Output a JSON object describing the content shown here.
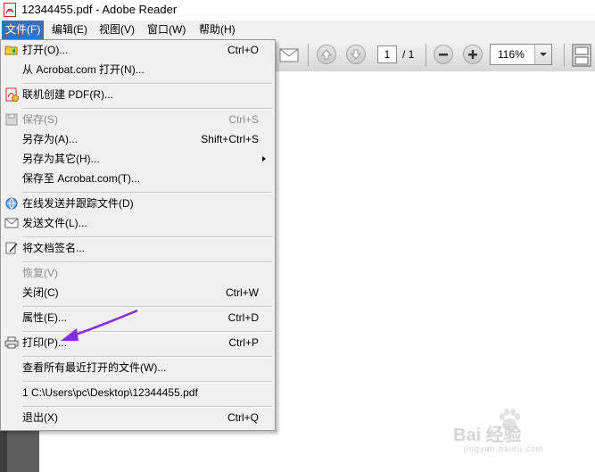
{
  "window": {
    "title": "12344455.pdf - Adobe Reader"
  },
  "menubar": {
    "items": [
      {
        "label": "文件(F)",
        "active": true
      },
      {
        "label": "编辑(E)"
      },
      {
        "label": "视图(V)"
      },
      {
        "label": "窗口(W)"
      },
      {
        "label": "帮助(H)"
      }
    ]
  },
  "toolbar": {
    "page_current": "1",
    "page_total": "/ 1",
    "zoom": "116%"
  },
  "file_menu": {
    "items": [
      {
        "label": "打开(O)...",
        "shortcut": "Ctrl+O",
        "icon": "open-folder-icon"
      },
      {
        "label": "从 Acrobat.com 打开(N)...",
        "shortcut": ""
      },
      {
        "label": "联机创建 PDF(R)...",
        "shortcut": "",
        "icon": "create-pdf-icon"
      },
      {
        "label": "保存(S)",
        "shortcut": "Ctrl+S",
        "disabled": true,
        "icon": "save-icon"
      },
      {
        "label": "另存为(A)...",
        "shortcut": "Shift+Ctrl+S"
      },
      {
        "label": "另存为其它(H)...",
        "shortcut": "",
        "submenu": true
      },
      {
        "label": "保存至 Acrobat.com(T)...",
        "shortcut": ""
      },
      {
        "label": "在线发送并跟踪文件(D)",
        "shortcut": "",
        "icon": "send-track-icon"
      },
      {
        "label": "发送文件(L)...",
        "shortcut": "",
        "icon": "envelope-icon"
      },
      {
        "label": "将文档签名...",
        "shortcut": "",
        "icon": "sign-document-icon"
      },
      {
        "label": "恢复(V)",
        "shortcut": "",
        "disabled": true
      },
      {
        "label": "关闭(C)",
        "shortcut": "Ctrl+W"
      },
      {
        "label": "属性(E)...",
        "shortcut": "Ctrl+D"
      },
      {
        "label": "打印(P)...",
        "shortcut": "Ctrl+P",
        "icon": "printer-icon"
      },
      {
        "label": "查看所有最近打开的文件(W)...",
        "shortcut": ""
      },
      {
        "label": "1 C:\\Users\\pc\\Desktop\\12344455.pdf",
        "shortcut": ""
      },
      {
        "label": "退出(X)",
        "shortcut": "Ctrl+Q"
      }
    ]
  },
  "watermark": {
    "text": "Bai 经验",
    "url": "jingyan.baidu.com"
  },
  "colors": {
    "menu_active": "#3b6fb6",
    "annotation_arrow": "#8a2be2"
  }
}
